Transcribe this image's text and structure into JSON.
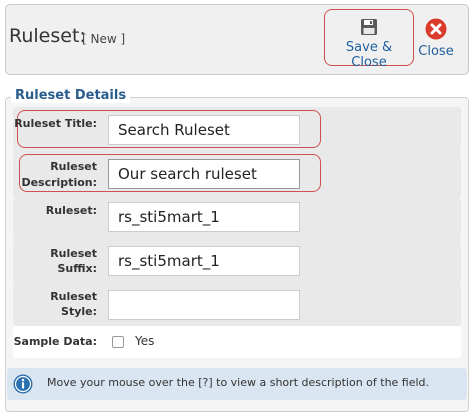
{
  "header": {
    "title": "Ruleset:",
    "subtitle": "[ New ]",
    "save_close_label": "Save & Close",
    "close_label": "Close"
  },
  "fieldset": {
    "legend": "Ruleset Details"
  },
  "fields": {
    "title": {
      "label": "Ruleset Title:",
      "value": "Search Ruleset"
    },
    "description": {
      "label_line1": "Ruleset",
      "label_line2": "Description:",
      "value": "Our search ruleset"
    },
    "ruleset": {
      "label": "Ruleset:",
      "value": "rs_sti5mart_1"
    },
    "suffix": {
      "label": "Ruleset Suffix:",
      "value": "rs_sti5mart_1"
    },
    "style": {
      "label": "Ruleset Style:",
      "value": ""
    },
    "sample": {
      "label": "Sample Data:",
      "option": "Yes",
      "checked": false
    }
  },
  "info": {
    "text": "Move your mouse over the [?] to view a short description of the field."
  },
  "colors": {
    "accent": "#2a5d8d",
    "highlight": "#d05050",
    "close_icon": "#d93a2b",
    "info_bg": "#d9e6f2"
  },
  "icons": {
    "save": "floppy-disk-icon",
    "close": "close-circle-icon",
    "info": "info-circle-icon"
  }
}
